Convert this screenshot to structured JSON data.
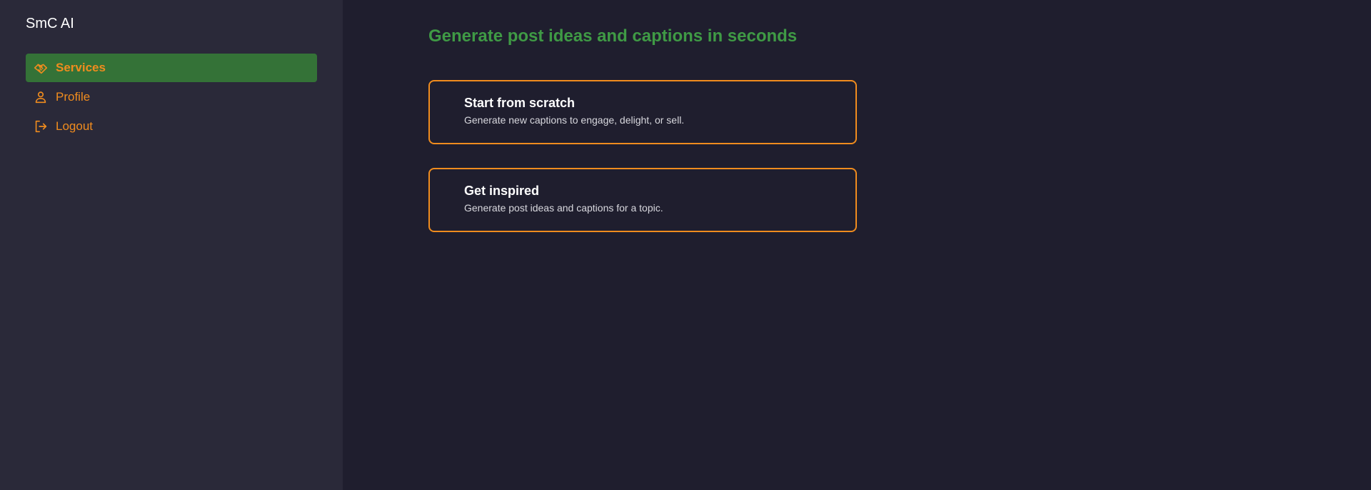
{
  "app": {
    "name": "SmC AI"
  },
  "sidebar": {
    "items": [
      {
        "label": "Services",
        "icon": "handshake-icon",
        "active": true
      },
      {
        "label": "Profile",
        "icon": "user-icon",
        "active": false
      },
      {
        "label": "Logout",
        "icon": "logout-icon",
        "active": false
      }
    ]
  },
  "main": {
    "title": "Generate post ideas and captions in seconds",
    "cards": [
      {
        "title": "Start from scratch",
        "description": "Generate new captions to engage, delight, or sell."
      },
      {
        "title": "Get inspired",
        "description": "Generate post ideas and captions for a topic."
      }
    ]
  },
  "colors": {
    "accent": "#f08c1e",
    "active_bg": "#347237",
    "title_green": "#3f9a45",
    "sidebar_bg": "#2a2939",
    "main_bg": "#1f1e2e"
  }
}
